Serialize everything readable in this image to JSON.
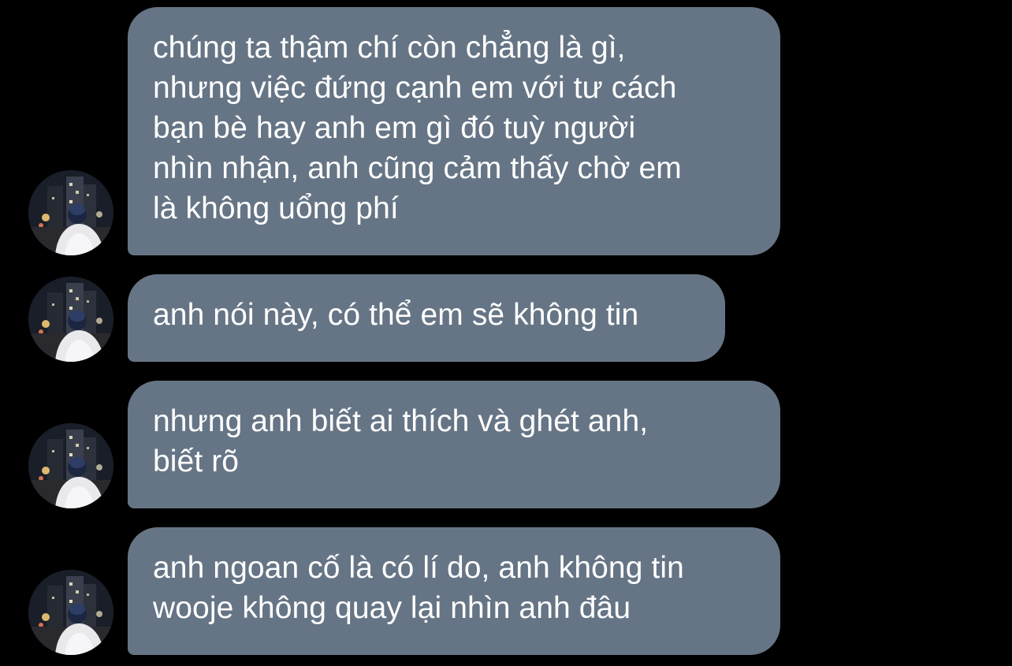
{
  "conversation": {
    "colors": {
      "background": "#000000",
      "bubble": "#667585",
      "text": "#ffffff"
    },
    "avatar_icon": "profile-photo-night-street",
    "messages": [
      {
        "lines": [
          "chúng ta thậm chí còn chẳng là gì,",
          "nhưng việc đứng cạnh em với tư cách",
          "bạn bè hay anh em gì đó tuỳ người",
          "nhìn nhận, anh cũng cảm thấy chờ em",
          "là không uổng phí"
        ]
      },
      {
        "lines": [
          "anh nói này, có thể em sẽ không tin"
        ]
      },
      {
        "lines": [
          "nhưng anh biết ai thích và ghét anh,",
          "biết rõ"
        ]
      },
      {
        "lines": [
          "anh ngoan cố là có lí do, anh không tin",
          "wooje không quay lại nhìn anh đâu"
        ]
      }
    ]
  }
}
